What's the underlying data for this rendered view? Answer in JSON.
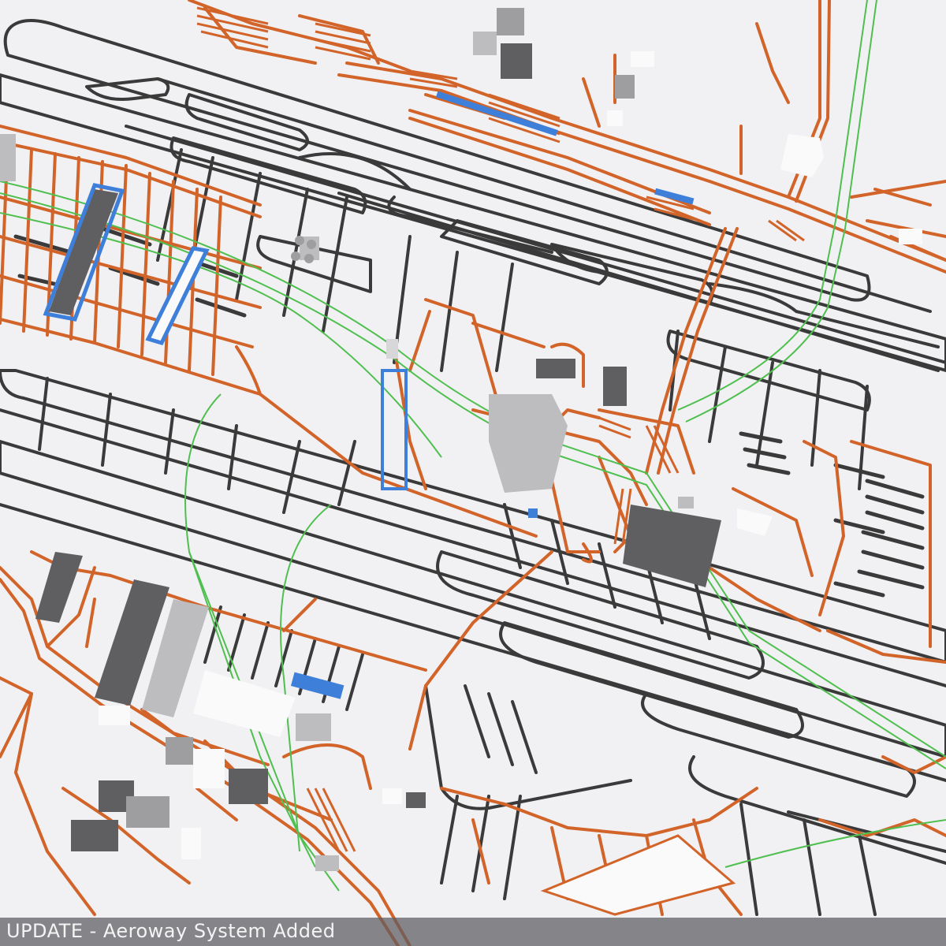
{
  "caption": {
    "text": "UPDATE - Aeroway System Added"
  },
  "legend_colors": {
    "background": "#f1f1f3",
    "aeroway_taxiway": "#3a3a3a",
    "roads": "#d2642a",
    "rail": "#4fbf4f",
    "water_blue": "#3d7fd9",
    "building_dark": "#5f5f62",
    "building_light": "#bdbdc0",
    "building_white": "#fafafa"
  }
}
